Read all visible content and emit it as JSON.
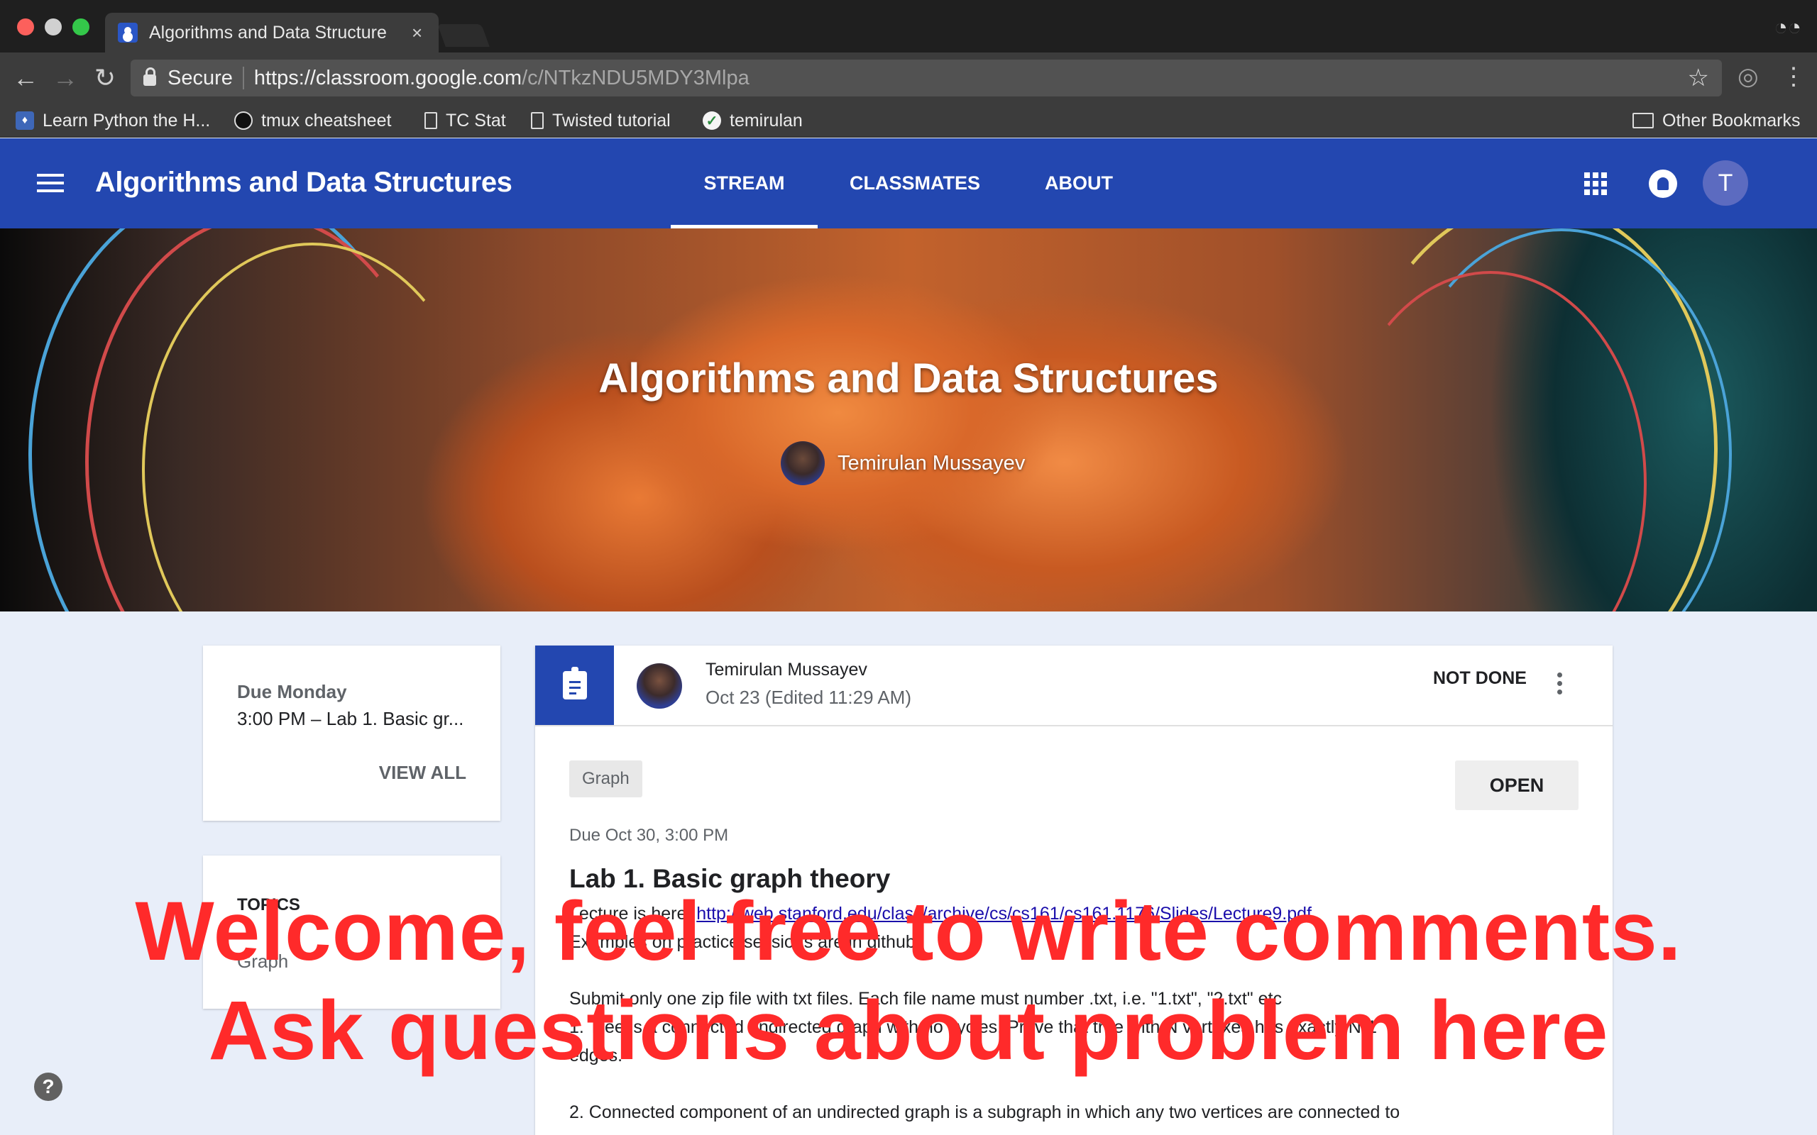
{
  "browser": {
    "tab_title": "Algorithms and Data Structure",
    "tab_close": "×",
    "secure_label": "Secure",
    "url_main": "https://classroom.google.com",
    "url_rest": "/c/NTkzNDU5MDY3Mlpa",
    "bookmarks": [
      {
        "label": "Learn Python the H...",
        "icon": "python-book-icon"
      },
      {
        "label": "tmux cheatsheet",
        "icon": "github-icon"
      },
      {
        "label": "TC Stat",
        "icon": "page-icon"
      },
      {
        "label": "Twisted tutorial",
        "icon": "page-icon"
      },
      {
        "label": "temirulan",
        "icon": "check-icon"
      }
    ],
    "other_bookmarks": "Other Bookmarks"
  },
  "appbar": {
    "title": "Algorithms and Data Structures",
    "tabs": [
      {
        "label": "STREAM",
        "active": true
      },
      {
        "label": "CLASSMATES",
        "active": false
      },
      {
        "label": "ABOUT",
        "active": false
      }
    ],
    "avatar_letter": "T",
    "accent_color": "#2347b0"
  },
  "banner": {
    "title": "Algorithms and Data Structures",
    "owner": "Temirulan Mussayev"
  },
  "upcoming": {
    "due_label": "Due Monday",
    "item": "3:00 PM – Lab 1. Basic gr...",
    "view_all": "VIEW ALL"
  },
  "topics": {
    "label": "TOPICS",
    "items": [
      "Graph"
    ]
  },
  "post": {
    "author": "Temirulan Mussayev",
    "date": "Oct 23 (Edited 11:29 AM)",
    "status": "NOT DONE",
    "topic": "Graph",
    "open_label": "OPEN",
    "due": "Due Oct 30, 3:00 PM",
    "title": "Lab 1. Basic graph theory",
    "lecture_prefix": "Lecture is here: ",
    "lecture_link": "http://web.stanford.edu/class/archive/cs/cs161/cs161.1176/Slides/Lecture9.pdf",
    "line2": "Examples on practice sessions are in github.",
    "line3": "Submit only one zip file with txt files. Each file name must number .txt, i.e. \"1.txt\", \"2.txt\" etc",
    "line4": "1. Tree is a connected undirected graph with no cycles. Prove that tree with N vertexes has exactly N-1",
    "line5": "edges.",
    "line6": "2. Connected component of an undirected graph is a subgraph in which any two vertices are connected to"
  },
  "overlay": {
    "line1": "Welcome, feel free to write comments.",
    "line2": "Ask questions about problem here",
    "color": "#ff2a2a"
  },
  "help": "?"
}
